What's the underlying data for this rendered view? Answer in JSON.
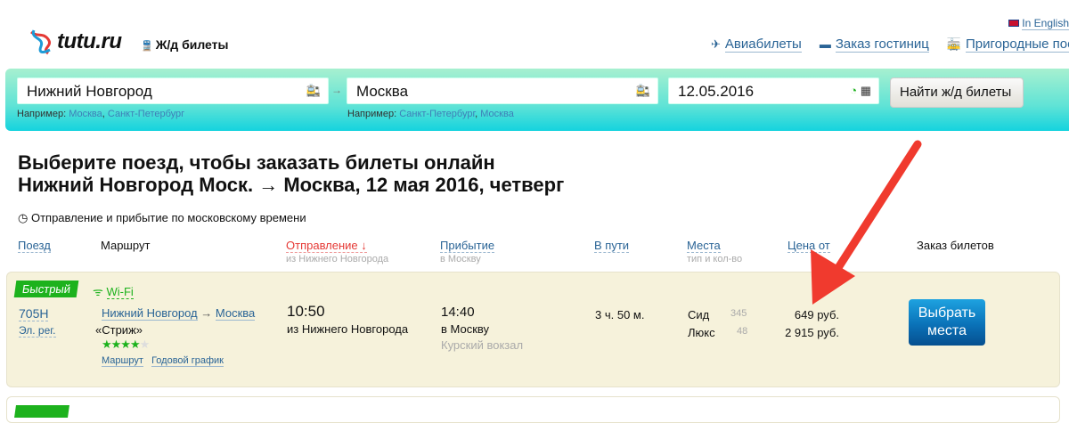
{
  "header": {
    "logo": "tutu.ru",
    "section": "Ж/д билеты",
    "lang": "In English",
    "links": [
      {
        "icon": "plane-icon",
        "label": "Авиабилеты"
      },
      {
        "icon": "bed-icon",
        "label": "Заказ гостиниц"
      },
      {
        "icon": "suburban-train-icon",
        "label": "Пригородные поезда"
      }
    ]
  },
  "search": {
    "from": "Нижний Новгород",
    "to": "Москва",
    "date": "12.05.2016",
    "button": "Найти ж/д билеты",
    "from_hint_label": "Например:",
    "from_hints": [
      "Москва",
      "Санкт-Петербург"
    ],
    "to_hint_label": "Например:",
    "to_hints": [
      "Санкт-Петербург",
      "Москва"
    ]
  },
  "title": {
    "line1": "Выберите поезд, чтобы заказать билеты онлайн",
    "line2": "Нижний Новгород Моск. → Москва, 12 мая 2016, четверг"
  },
  "timezone_note": "Отправление и прибытие по московскому времени",
  "columns": {
    "train": "Поезд",
    "route": "Маршрут",
    "departure": "Отправление ↓",
    "departure_sub": "из Нижнего Новгорода",
    "arrival": "Прибытие",
    "arrival_sub": "в Москву",
    "duration": "В пути",
    "seats": "Места",
    "seats_sub": "тип и кол-во",
    "price": "Цена от",
    "order": "Заказ билетов"
  },
  "trains": [
    {
      "badge": "Быстрый",
      "wifi": "Wi-Fi",
      "number": "705Н",
      "type": "Эл. рег.",
      "from": "Нижний Новгород",
      "to": "Москва",
      "name": "«Стриж»",
      "rating": 4,
      "rating_max": 5,
      "route_link": "Маршрут",
      "schedule_link": "Годовой график",
      "dep_time": "10:50",
      "dep_place": "из Нижнего Новгорода",
      "arr_time": "14:40",
      "arr_place": "в Москву",
      "arr_station": "Курский вокзал",
      "duration": "3 ч. 50 м.",
      "seats": [
        {
          "type": "Сид",
          "count": "345",
          "price": "649 руб."
        },
        {
          "type": "Люкс",
          "count": "48",
          "price": "2 915 руб."
        }
      ],
      "button": "Выбрать места"
    }
  ],
  "colors": {
    "accent": "#1db21d",
    "link": "#2a6496",
    "sort_active": "#e53935",
    "annotation_arrow": "#f03a2e"
  }
}
